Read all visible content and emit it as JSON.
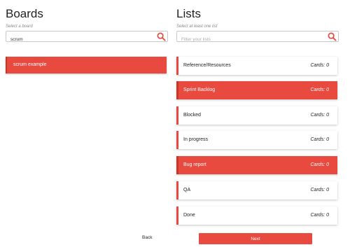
{
  "boards": {
    "title": "Boards",
    "subtitle": "Select a board",
    "search_value": "scrum",
    "search_placeholder": "",
    "items": [
      {
        "label": "scrum example",
        "selected": true
      }
    ]
  },
  "lists": {
    "title": "Lists",
    "subtitle": "Select at least one list",
    "search_placeholder": "Filter your lists",
    "items": [
      {
        "label": "Reference/Resources",
        "cards": "Cards: 0",
        "selected": false
      },
      {
        "label": "Sprint Backlog",
        "cards": "Cards: 0",
        "selected": true
      },
      {
        "label": "Blocked",
        "cards": "Cards: 0",
        "selected": false
      },
      {
        "label": "In progress",
        "cards": "Cards: 0",
        "selected": false
      },
      {
        "label": "Bug report",
        "cards": "Cards: 0",
        "selected": true
      },
      {
        "label": "QA",
        "cards": "Cards: 0",
        "selected": false
      },
      {
        "label": "Done",
        "cards": "Cards: 0",
        "selected": false
      }
    ]
  },
  "footer": {
    "back_label": "Back",
    "next_label": "Next"
  },
  "colors": {
    "accent": "#e84a3f",
    "accent_dark": "#c0392b"
  },
  "icons": {
    "search": "search-icon"
  }
}
